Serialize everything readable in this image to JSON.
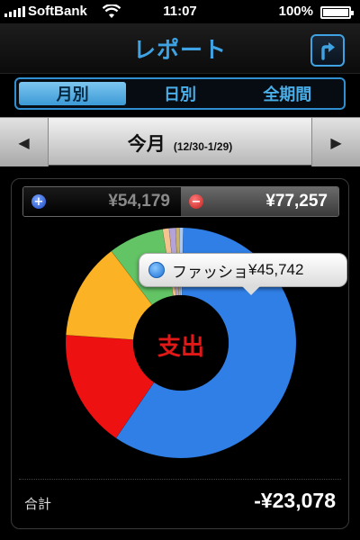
{
  "status_bar": {
    "carrier": "SoftBank",
    "time": "11:07",
    "battery": "100%",
    "battery_level": 1.0
  },
  "nav": {
    "title": "レポート",
    "share_icon": "share-icon"
  },
  "segments": {
    "items": [
      {
        "label": "月別",
        "active": true
      },
      {
        "label": "日別",
        "active": false
      },
      {
        "label": "全期間",
        "active": false
      }
    ]
  },
  "period": {
    "prev_icon": "triangle-left-icon",
    "next_icon": "triangle-right-icon",
    "label": "今月",
    "range": "(12/30-1/29)"
  },
  "totals": {
    "income_icon": "plus-circle-icon",
    "income": "¥54,179",
    "expense_icon": "minus-circle-icon",
    "expense": "¥77,257"
  },
  "chart_data": {
    "type": "pie",
    "center_label": "支出",
    "slices": [
      {
        "value": 45742,
        "color": "#2f7fe6"
      },
      {
        "value": 12800,
        "color": "#ee1111"
      },
      {
        "value": 10500,
        "color": "#fbb224"
      },
      {
        "value": 6000,
        "color": "#62c464"
      },
      {
        "value": 700,
        "color": "#f3c48e"
      },
      {
        "value": 700,
        "color": "#b3a3d9"
      },
      {
        "value": 400,
        "color": "#c9b36c"
      },
      {
        "value": 415,
        "color": "#a9c8f4"
      }
    ]
  },
  "callout": {
    "name": "ファッショ",
    "value": "¥45,742"
  },
  "summary": {
    "label": "合計",
    "value": "-¥23,078"
  }
}
